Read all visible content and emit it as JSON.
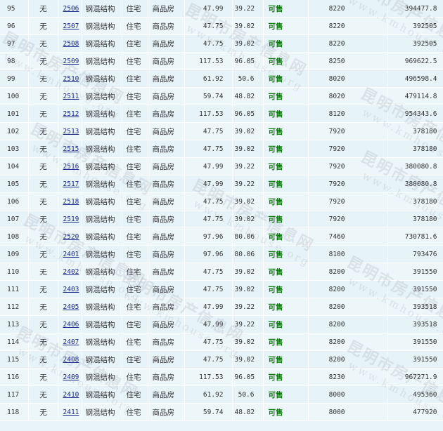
{
  "rows": [
    {
      "idx": "95",
      "flag": "无",
      "room": "2506",
      "structure": "钢混结构",
      "use": "住宅",
      "type": "商品房",
      "area": "47.99",
      "inner": "39.22",
      "status": "可售",
      "price": "8220",
      "total": "394477.8"
    },
    {
      "idx": "96",
      "flag": "无",
      "room": "2507",
      "structure": "钢混结构",
      "use": "住宅",
      "type": "商品房",
      "area": "47.75",
      "inner": "39.02",
      "status": "可售",
      "price": "8220",
      "total": "392505"
    },
    {
      "idx": "97",
      "flag": "无",
      "room": "2508",
      "structure": "钢混结构",
      "use": "住宅",
      "type": "商品房",
      "area": "47.75",
      "inner": "39.02",
      "status": "可售",
      "price": "8220",
      "total": "392505"
    },
    {
      "idx": "98",
      "flag": "无",
      "room": "2509",
      "structure": "钢混结构",
      "use": "住宅",
      "type": "商品房",
      "area": "117.53",
      "inner": "96.05",
      "status": "可售",
      "price": "8250",
      "total": "969622.5"
    },
    {
      "idx": "99",
      "flag": "无",
      "room": "2510",
      "structure": "钢混结构",
      "use": "住宅",
      "type": "商品房",
      "area": "61.92",
      "inner": "50.6",
      "status": "可售",
      "price": "8020",
      "total": "496598.4"
    },
    {
      "idx": "100",
      "flag": "无",
      "room": "2511",
      "structure": "钢混结构",
      "use": "住宅",
      "type": "商品房",
      "area": "59.74",
      "inner": "48.82",
      "status": "可售",
      "price": "8020",
      "total": "479114.8"
    },
    {
      "idx": "101",
      "flag": "无",
      "room": "2512",
      "structure": "钢混结构",
      "use": "住宅",
      "type": "商品房",
      "area": "117.53",
      "inner": "96.05",
      "status": "可售",
      "price": "8120",
      "total": "954343.6"
    },
    {
      "idx": "102",
      "flag": "无",
      "room": "2513",
      "structure": "钢混结构",
      "use": "住宅",
      "type": "商品房",
      "area": "47.75",
      "inner": "39.02",
      "status": "可售",
      "price": "7920",
      "total": "378180"
    },
    {
      "idx": "103",
      "flag": "无",
      "room": "2515",
      "structure": "钢混结构",
      "use": "住宅",
      "type": "商品房",
      "area": "47.75",
      "inner": "39.02",
      "status": "可售",
      "price": "7920",
      "total": "378180"
    },
    {
      "idx": "104",
      "flag": "无",
      "room": "2516",
      "structure": "钢混结构",
      "use": "住宅",
      "type": "商品房",
      "area": "47.99",
      "inner": "39.22",
      "status": "可售",
      "price": "7920",
      "total": "380080.8"
    },
    {
      "idx": "105",
      "flag": "无",
      "room": "2517",
      "structure": "钢混结构",
      "use": "住宅",
      "type": "商品房",
      "area": "47.99",
      "inner": "39.22",
      "status": "可售",
      "price": "7920",
      "total": "380080.8"
    },
    {
      "idx": "106",
      "flag": "无",
      "room": "2518",
      "structure": "钢混结构",
      "use": "住宅",
      "type": "商品房",
      "area": "47.75",
      "inner": "39.02",
      "status": "可售",
      "price": "7920",
      "total": "378180"
    },
    {
      "idx": "107",
      "flag": "无",
      "room": "2519",
      "structure": "钢混结构",
      "use": "住宅",
      "type": "商品房",
      "area": "47.75",
      "inner": "39.02",
      "status": "可售",
      "price": "7920",
      "total": "378180"
    },
    {
      "idx": "108",
      "flag": "无",
      "room": "2520",
      "structure": "钢混结构",
      "use": "住宅",
      "type": "商品房",
      "area": "97.96",
      "inner": "80.06",
      "status": "可售",
      "price": "7460",
      "total": "730781.6"
    },
    {
      "idx": "109",
      "flag": "无",
      "room": "2401",
      "structure": "钢混结构",
      "use": "住宅",
      "type": "商品房",
      "area": "97.96",
      "inner": "80.06",
      "status": "可售",
      "price": "8100",
      "total": "793476"
    },
    {
      "idx": "110",
      "flag": "无",
      "room": "2402",
      "structure": "钢混结构",
      "use": "住宅",
      "type": "商品房",
      "area": "47.75",
      "inner": "39.02",
      "status": "可售",
      "price": "8200",
      "total": "391550"
    },
    {
      "idx": "111",
      "flag": "无",
      "room": "2403",
      "structure": "钢混结构",
      "use": "住宅",
      "type": "商品房",
      "area": "47.75",
      "inner": "39.02",
      "status": "可售",
      "price": "8200",
      "total": "391550"
    },
    {
      "idx": "112",
      "flag": "无",
      "room": "2405",
      "structure": "钢混结构",
      "use": "住宅",
      "type": "商品房",
      "area": "47.99",
      "inner": "39.22",
      "status": "可售",
      "price": "8200",
      "total": "393518"
    },
    {
      "idx": "113",
      "flag": "无",
      "room": "2406",
      "structure": "钢混结构",
      "use": "住宅",
      "type": "商品房",
      "area": "47.99",
      "inner": "39.22",
      "status": "可售",
      "price": "8200",
      "total": "393518"
    },
    {
      "idx": "114",
      "flag": "无",
      "room": "2407",
      "structure": "钢混结构",
      "use": "住宅",
      "type": "商品房",
      "area": "47.75",
      "inner": "39.02",
      "status": "可售",
      "price": "8200",
      "total": "391550"
    },
    {
      "idx": "115",
      "flag": "无",
      "room": "2408",
      "structure": "钢混结构",
      "use": "住宅",
      "type": "商品房",
      "area": "47.75",
      "inner": "39.02",
      "status": "可售",
      "price": "8200",
      "total": "391550"
    },
    {
      "idx": "116",
      "flag": "无",
      "room": "2409",
      "structure": "钢混结构",
      "use": "住宅",
      "type": "商品房",
      "area": "117.53",
      "inner": "96.05",
      "status": "可售",
      "price": "8230",
      "total": "967271.9"
    },
    {
      "idx": "117",
      "flag": "无",
      "room": "2410",
      "structure": "钢混结构",
      "use": "住宅",
      "type": "商品房",
      "area": "61.92",
      "inner": "50.6",
      "status": "可售",
      "price": "8000",
      "total": "495360"
    },
    {
      "idx": "118",
      "flag": "无",
      "room": "2411",
      "structure": "钢混结构",
      "use": "住宅",
      "type": "商品房",
      "area": "59.74",
      "inner": "48.82",
      "status": "可售",
      "price": "8000",
      "total": "477920"
    }
  ],
  "watermark": {
    "cn": "昆明市房产信息网",
    "en": "www.kmhouse.org"
  },
  "colors": {
    "row_odd": "#e6f3f8",
    "row_even": "#edf7fa",
    "room_link": "#1a2a8c",
    "status_available": "#0a7d0a"
  }
}
